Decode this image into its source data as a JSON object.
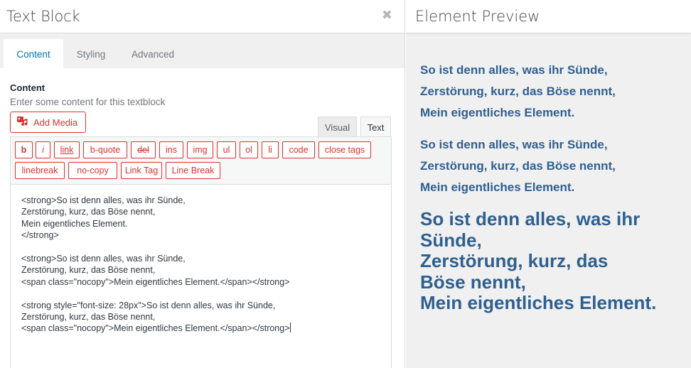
{
  "editor": {
    "title": "Text Block",
    "close_glyph": "✖",
    "tabs": [
      {
        "label": "Content",
        "active": true
      },
      {
        "label": "Styling",
        "active": false
      },
      {
        "label": "Advanced",
        "active": false
      }
    ],
    "field_label": "Content",
    "field_description": "Enter some content for this textblock",
    "add_media_label": "Add Media",
    "mode_tabs": {
      "visual": "Visual",
      "text": "Text"
    },
    "quicktags": [
      "b",
      "i",
      "link",
      "b-quote",
      "del",
      "ins",
      "img",
      "ul",
      "ol",
      "li",
      "code",
      "close tags",
      "linebreak",
      "no-copy",
      "Link Tag",
      "Line Break"
    ],
    "source_text": "<strong>So ist denn alles, was ihr Sünde,\nZerstörung, kurz, das Böse nennt,\nMein eigentliches Element.\n</strong>\n\n<strong>So ist denn alles, was ihr Sünde,\nZerstörung, kurz, das Böse nennt,\n<span class=\"nocopy\">Mein eigentliches Element.</span></strong>\n\n<strong style=\"font-size: 28px\">So ist denn alles, was ihr Sünde,\nZerstörung, kurz, das Böse nennt,\n<span class=\"nocopy\">Mein eigentliches Element.</span></strong>"
  },
  "preview": {
    "title": "Element Preview",
    "paragraphs": [
      [
        "So ist denn alles, was ihr Sünde,",
        "Zerstörung, kurz, das Böse nennt,",
        "Mein eigentliches Element."
      ],
      [
        "So ist denn alles, was ihr Sünde,",
        "Zerstörung, kurz, das Böse nennt,",
        "Mein eigentliches Element."
      ],
      [
        "So ist denn alles, was ihr",
        "Sünde,",
        "Zerstörung, kurz, das",
        "Böse nennt,",
        "Mein eigentliches Element."
      ]
    ]
  },
  "colors": {
    "accent_red": "#dc3232",
    "tab_active_blue": "#0073aa",
    "preview_text_blue": "#2f5f8f"
  },
  "icons": {
    "add_media": "media-icon",
    "close": "close-icon"
  }
}
